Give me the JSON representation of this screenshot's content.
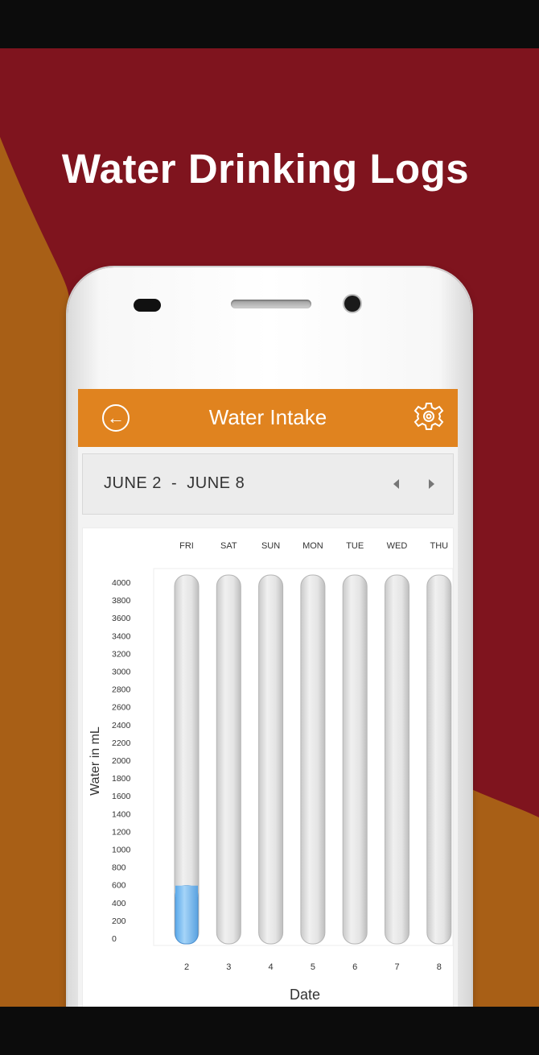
{
  "headline": "Water Drinking Logs",
  "colors": {
    "brand_red": "#7f141e",
    "brand_orange": "#a85f16",
    "appbar": "#e0831f",
    "water_fill": "#7fbff2",
    "bar_track": "#e6e6e6"
  },
  "appbar": {
    "title": "Water Intake",
    "back_icon": "back-arrow-circle-icon",
    "settings_icon": "gear-icon"
  },
  "date_bar": {
    "range": "JUNE 2  -  JUNE 8",
    "prev_icon": "triangle-left-icon",
    "next_icon": "triangle-right-icon"
  },
  "chart_data": {
    "type": "bar",
    "title": "",
    "xlabel": "Date",
    "ylabel": "Water in mL",
    "categories": [
      "FRI",
      "SAT",
      "SUN",
      "MON",
      "TUE",
      "WED",
      "THU"
    ],
    "dates": [
      "2",
      "3",
      "4",
      "5",
      "6",
      "7",
      "8"
    ],
    "values": [
      600,
      0,
      0,
      0,
      0,
      0,
      0
    ],
    "ylim": [
      0,
      4000
    ],
    "yticks": [
      0,
      200,
      400,
      600,
      800,
      1000,
      1200,
      1400,
      1600,
      1800,
      2000,
      2200,
      2400,
      2600,
      2800,
      3000,
      3200,
      3400,
      3600,
      3800,
      4000
    ],
    "grid": false,
    "legend": "none"
  }
}
